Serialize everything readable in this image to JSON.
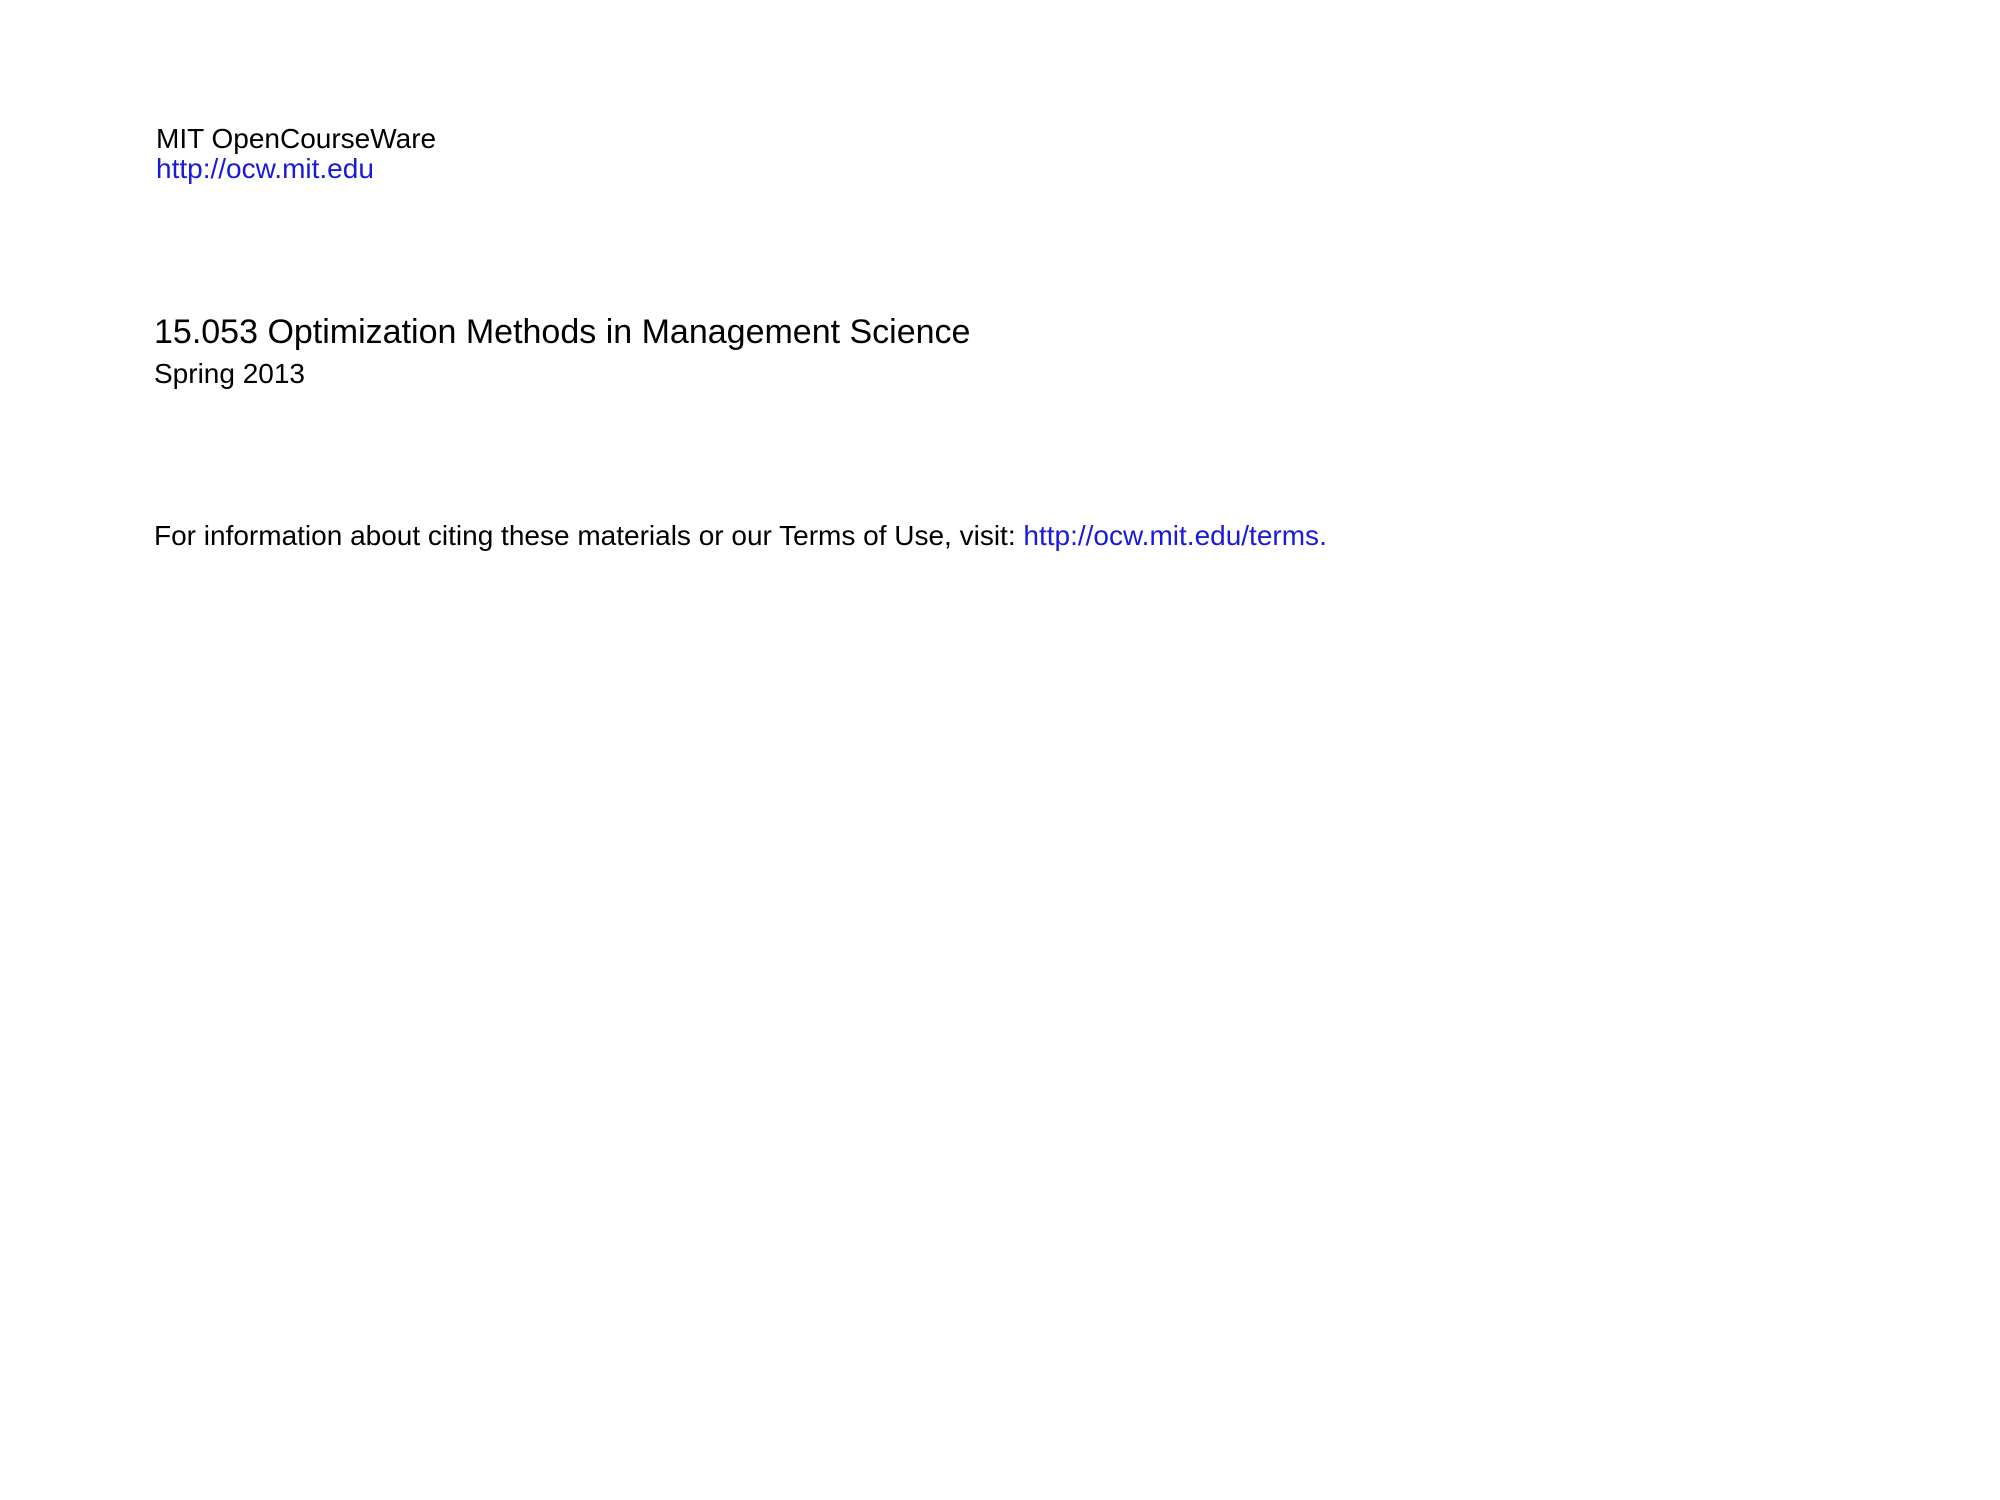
{
  "header": {
    "org_name": "MIT OpenCourseWare",
    "org_url": "http://ocw.mit.edu"
  },
  "course": {
    "title": "15.053 Optimization Methods in Management Science",
    "term": "Spring 2013"
  },
  "citation": {
    "text": "For information about citing these materials or our Terms of Use, visit: ",
    "link": "http://ocw.mit.edu/terms",
    "trailing": "."
  },
  "colors": {
    "link": "#1a1adb",
    "text": "#000000",
    "background": "#ffffff"
  }
}
